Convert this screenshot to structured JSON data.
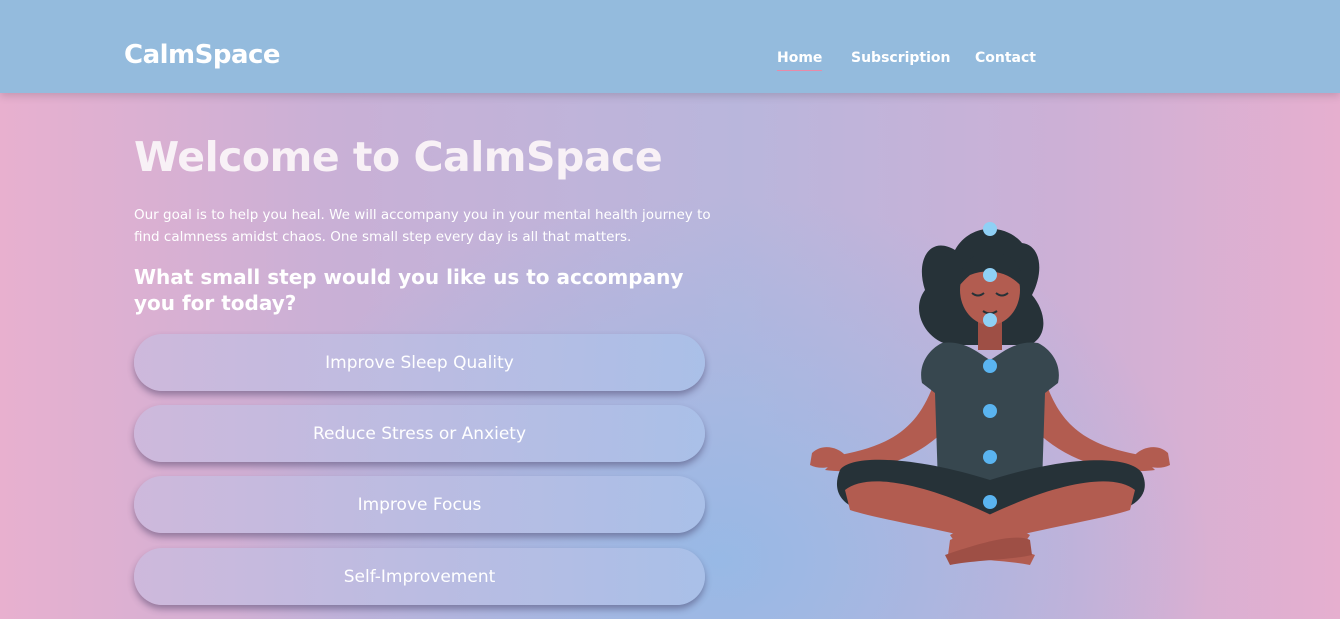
{
  "header": {
    "brand": "CalmSpace",
    "nav": [
      {
        "label": "Home",
        "active": true
      },
      {
        "label": "Subscription",
        "active": false
      },
      {
        "label": "Contact",
        "active": false
      }
    ]
  },
  "hero": {
    "title": "Welcome to CalmSpace",
    "description": "Our goal is to help you heal. We will accompany you in your mental health journey to find calmness amidst chaos. One small step every day is all that matters.",
    "question": "What small step would you like us to accompany you for today?",
    "options": [
      "Improve Sleep Quality",
      "Reduce Stress or Anxiety",
      "Improve Focus",
      "Self-Improvement"
    ]
  },
  "illustration": {
    "name": "meditating-woman-illustration",
    "colors": {
      "skin": "#b25c50",
      "hair": "#263238",
      "shirt": "#37474f",
      "pants": "#263238",
      "chakra": "#5ab4f0"
    }
  },
  "colors": {
    "navbar": "#94bbdd",
    "active_underline": "#e98aa8"
  }
}
